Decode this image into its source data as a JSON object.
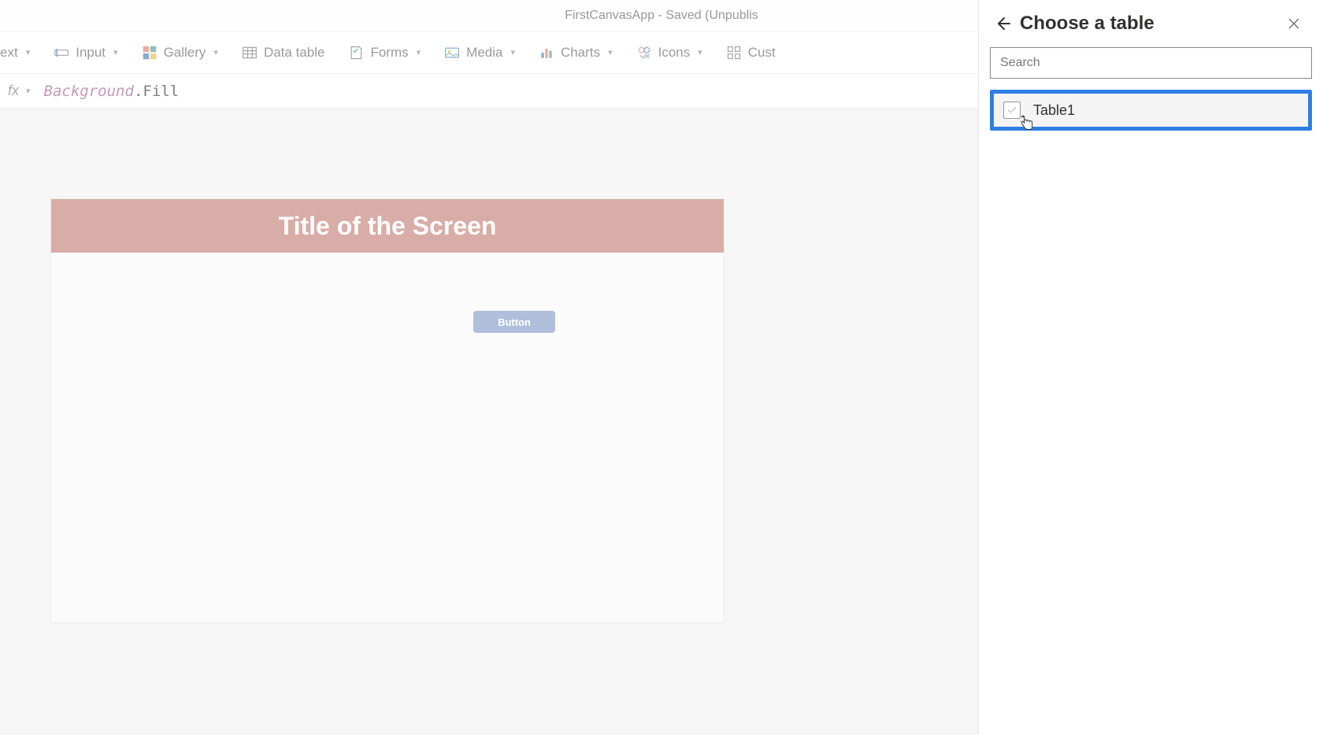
{
  "titlebar": {
    "text": "FirstCanvasApp - Saved (Unpublis"
  },
  "ribbon": {
    "text": {
      "label": "ext"
    },
    "input": {
      "label": "Input"
    },
    "gallery": {
      "label": "Gallery"
    },
    "data_table": {
      "label": "Data table"
    },
    "forms": {
      "label": "Forms"
    },
    "media": {
      "label": "Media"
    },
    "charts": {
      "label": "Charts"
    },
    "icons": {
      "label": "Icons"
    },
    "custom": {
      "label": "Cust"
    }
  },
  "formula": {
    "fx": "fx",
    "expr_obj": "Background",
    "expr_prop": ".Fill"
  },
  "canvas": {
    "header": "Title of the Screen",
    "button_label": "Button"
  },
  "panel": {
    "title": "Choose a table",
    "search_placeholder": "Search",
    "items": [
      {
        "name": "Table1"
      }
    ]
  }
}
